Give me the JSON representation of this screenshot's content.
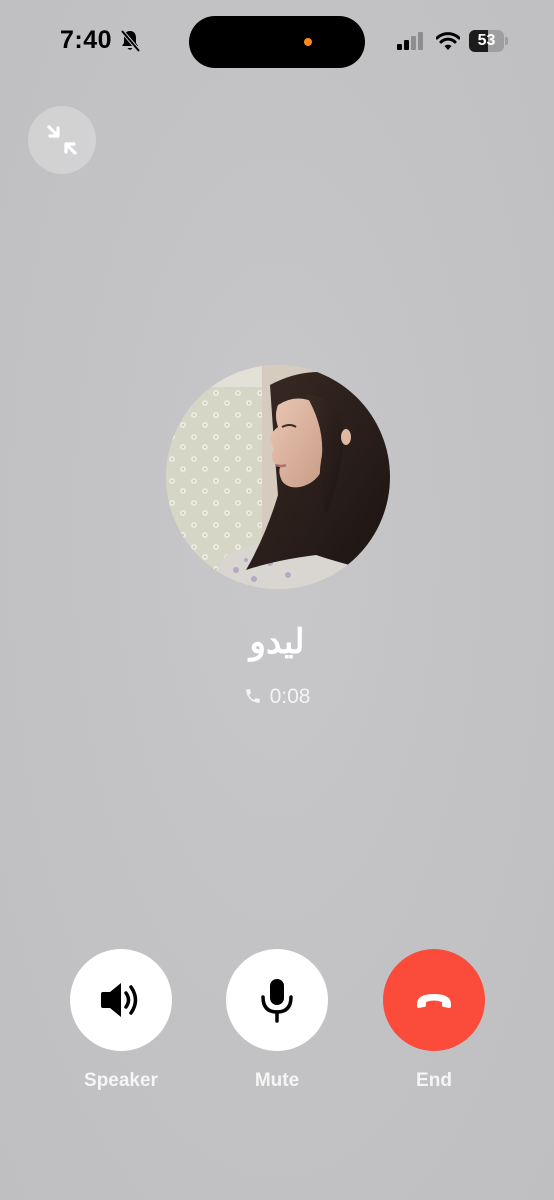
{
  "status_bar": {
    "time": "7:40",
    "battery_level": "53",
    "battery_fraction": 0.53
  },
  "call": {
    "contact_name": "ليدو",
    "duration": "0:08"
  },
  "controls": {
    "speaker_label": "Speaker",
    "mute_label": "Mute",
    "end_label": "End"
  },
  "colors": {
    "background": "#c3c3c5",
    "end_button": "#fa4b3b",
    "control_button": "#ffffff",
    "island_indicator": "#ff8a1a"
  },
  "icons": {
    "status": [
      "bell-slash-icon",
      "cellular-signal-icon",
      "wifi-icon",
      "battery-icon"
    ],
    "minimize": "collapse-arrows-icon",
    "duration": "phone-icon",
    "speaker": "speaker-wave-icon",
    "mute": "microphone-icon",
    "end": "phone-down-icon"
  }
}
